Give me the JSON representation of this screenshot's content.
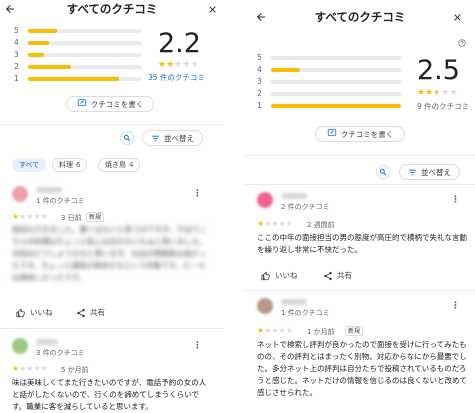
{
  "left": {
    "title": "すべてのクチコミ",
    "distribution_labels": [
      "5",
      "4",
      "3",
      "2",
      "1"
    ],
    "distribution_fractions": [
      0.25,
      0.18,
      0.14,
      0.38,
      0.8
    ],
    "rating": "2.2",
    "stars_filled": 2,
    "review_count": "35 件のクチコミ",
    "write_review": "クチコミを書く",
    "sort": "並べ替え",
    "chips": [
      {
        "label": "すべて",
        "count": ""
      },
      {
        "label": "料理",
        "count": "6"
      },
      {
        "label": "焼き鳥",
        "count": "4"
      }
    ],
    "reviews": [
      {
        "meta": "1 件のクチコミ",
        "stars": 1,
        "date": "3 日前",
        "badge": "新規",
        "text": "前回も行きました。悪くはないと思うのですが、やはりこちらの料理はちょっと私には合わないなぁと思いました。次回はどうしようかなと思います。お店の雰囲気は良かったです。ちょっと値段が高めかなという印象です。ビールは美味しかったです。",
        "like": "いいね",
        "share": "共有"
      },
      {
        "meta": "3 件のクチコミ",
        "stars": 1,
        "date": "5 か月前",
        "text": "味は美味しくてまた行きたいのですが、電話予約の女の人と話がしたくないので、行くのを諦めてしまうくらいです。職業に客を減らしていると思います。"
      }
    ]
  },
  "right": {
    "title": "すべてのクチコミ",
    "distribution_labels": [
      "5",
      "4",
      "3",
      "2",
      "1"
    ],
    "distribution_fractions": [
      0.0,
      0.22,
      0.0,
      0.0,
      1.0
    ],
    "rating": "2.5",
    "stars_filled": 2.5,
    "review_count": "9 件のクチコミ",
    "write_review": "クチコミを書く",
    "sort": "並べ替え",
    "reviews": [
      {
        "meta": "2 件のクチコミ",
        "stars": 1,
        "date": "2 週間前",
        "text": "ここの中年の面接担当の男の態度が高圧的で横柄で失礼な言動を繰り返し非常に不快だった。",
        "like": "いいね",
        "share": "共有"
      },
      {
        "meta": "1 件のクチコミ",
        "stars": 1,
        "date": "1 か月前",
        "badge": "新規",
        "text": "ネットで検索し評判が良かったので面接を受けに行ってみたものの、その評判とはまったく別物。対応からなにから最悪でした。多分ネット上の評判は自分たちで投稿されているものだろうと感じた。ネットだけの情報を信じるのは良くないと改めて感じさせられた。"
      }
    ]
  },
  "colors": {
    "star": "#fbbc04",
    "link": "#1a73e8",
    "chip_active_bg": "#e8f0fe"
  }
}
